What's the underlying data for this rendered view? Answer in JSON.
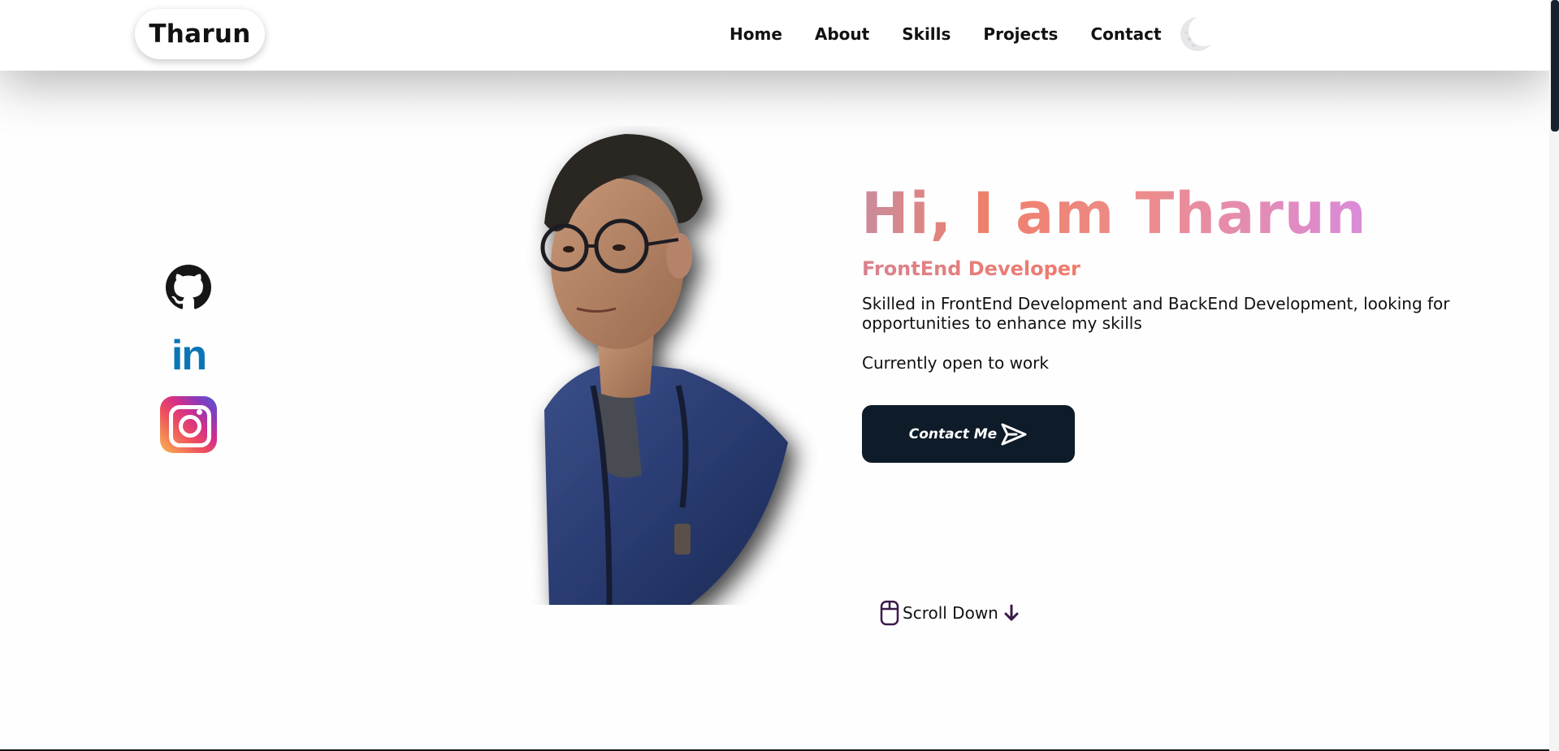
{
  "navbar": {
    "brand": "Tharun",
    "links": [
      "Home",
      "About",
      "Skills",
      "Projects",
      "Contact"
    ],
    "theme_toggle_icon": "moon-icon"
  },
  "socials": [
    {
      "name": "github",
      "icon": "github-icon"
    },
    {
      "name": "linkedin",
      "icon": "linkedin-icon",
      "text": "in"
    },
    {
      "name": "instagram",
      "icon": "instagram-icon"
    }
  ],
  "hero": {
    "title": "Hi, I am Tharun",
    "subtitle": "FrontEnd Developer",
    "description": "Skilled in FrontEnd Development and BackEnd Development, looking for opportunities to enhance my skills",
    "status": "Currently open to work",
    "cta_label": "Contact Me",
    "cta_icon": "send-icon",
    "scroll_label": "Scroll Down",
    "scroll_icons": [
      "mouse-icon",
      "arrow-down-icon"
    ]
  },
  "colors": {
    "button_bg": "#0e1b28",
    "title_gradient": [
      "#c98c9c",
      "#f07f6a",
      "#da8bdc"
    ],
    "subtitle": "#e67f78",
    "linkedin": "#0a75b5",
    "scroll_accent": "#3b1a4a"
  }
}
